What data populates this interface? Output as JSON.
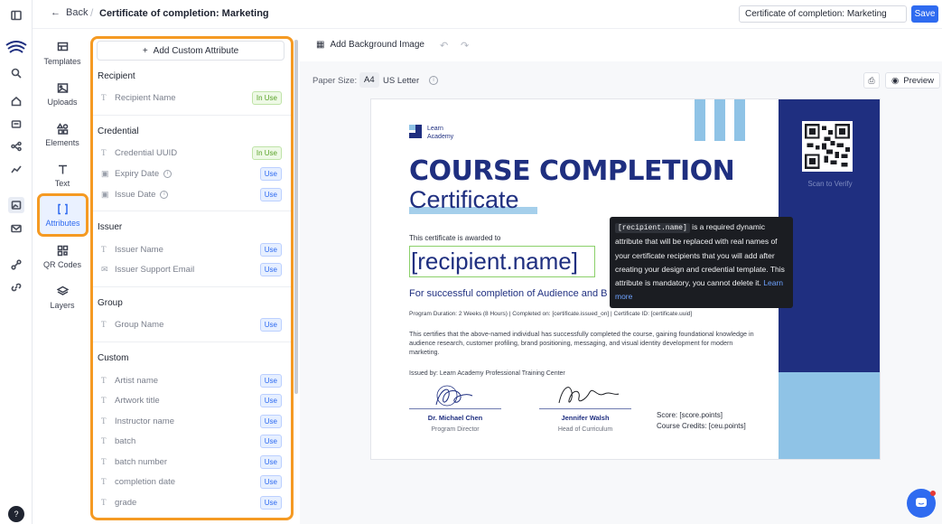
{
  "header": {
    "back_label": "Back",
    "title": "Certificate of completion: Marketing",
    "title_input_value": "Certificate of completion: Marketing",
    "save_label": "Save"
  },
  "tools": [
    {
      "label": "Templates",
      "icon": "templates-icon"
    },
    {
      "label": "Uploads",
      "icon": "image-icon"
    },
    {
      "label": "Elements",
      "icon": "shapes-icon"
    },
    {
      "label": "Text",
      "icon": "text-icon"
    },
    {
      "label": "Attributes",
      "icon": "brackets-icon",
      "active": true
    },
    {
      "label": "QR Codes",
      "icon": "qr-icon"
    },
    {
      "label": "Layers",
      "icon": "layers-icon"
    }
  ],
  "attributes_panel": {
    "add_label": "Add Custom Attribute",
    "use_label": "Use",
    "in_use_label": "In Use",
    "sections": {
      "recipient": {
        "title": "Recipient",
        "items": [
          "Recipient Name"
        ]
      },
      "credential": {
        "title": "Credential",
        "items": [
          "Credential UUID",
          "Expiry Date",
          "Issue Date"
        ]
      },
      "issuer": {
        "title": "Issuer",
        "items": [
          "Issuer Name",
          "Issuer Support Email"
        ]
      },
      "group": {
        "title": "Group",
        "items": [
          "Group Name"
        ]
      },
      "custom": {
        "title": "Custom",
        "items": [
          "Artist name",
          "Artwork title",
          "Instructor name",
          "batch",
          "batch number",
          "completion date",
          "grade"
        ]
      }
    }
  },
  "canvas_toolbar": {
    "add_background": "Add Background Image",
    "paper_size_label": "Paper Size:",
    "paper_a4": "A4",
    "paper_us": "US Letter",
    "preview_label": "Preview"
  },
  "certificate": {
    "logo_line1": "Learn",
    "logo_line2": "Academy",
    "heading": "COURSE COMPLETION",
    "subheading": "Certificate",
    "awarded": "This certificate is awarded to",
    "recipient_placeholder": "[recipient.name]",
    "completion_line": "For successful completion of Audience and B",
    "meta_line": "Program Duration: 2 Weeks (8 Hours)  |        Completed on: [certificate.issued_on]  |  Certificate ID: [certificate.uuid]",
    "body": "This certifies that the above-named individual has successfully completed the course, gaining foundational knowledge in audience research, customer profiling, brand positioning, messaging, and visual identity development for modern marketing.",
    "issued_by": "Issued by: Learn Academy Professional Training Center",
    "signer1_name": "Dr. Michael Chen",
    "signer1_role": "Program Director",
    "signer2_name": "Jennifer Walsh",
    "signer2_role": "Head of Curriculum",
    "score": "Score: [score.points]",
    "credits": "Course Credits: [ceu.points]",
    "scan_label": "Scan to Verify",
    "colors": {
      "navy": "#1f2f80",
      "light_blue": "#8fc3e6"
    }
  },
  "tooltip": {
    "code": "[recipient.name]",
    "text": " is a required dynamic attribute that will be replaced with real names of your certificate recipients that you will add after creating your design and credential template. This attribute is mandatory, you cannot delete it. ",
    "link": "Learn more"
  }
}
